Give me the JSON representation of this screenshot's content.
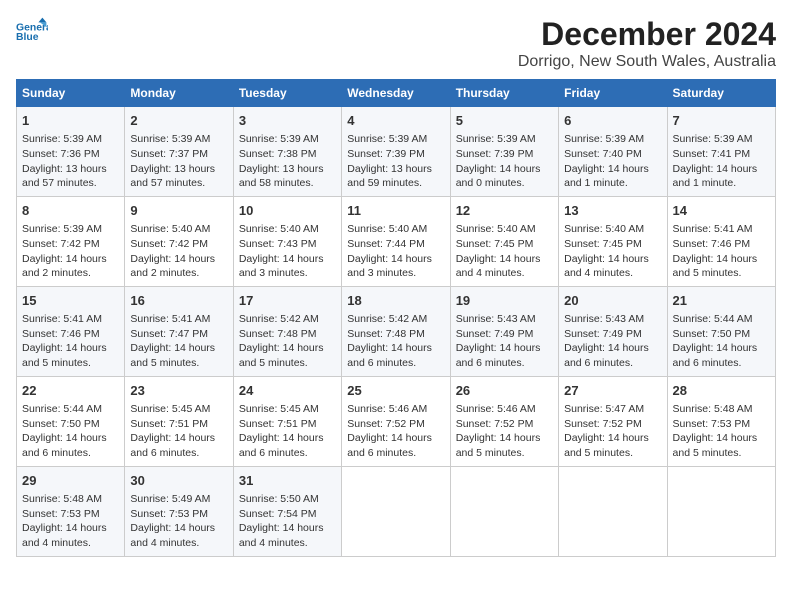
{
  "logo": {
    "line1": "General",
    "line2": "Blue"
  },
  "title": "December 2024",
  "subtitle": "Dorrigo, New South Wales, Australia",
  "days_of_week": [
    "Sunday",
    "Monday",
    "Tuesday",
    "Wednesday",
    "Thursday",
    "Friday",
    "Saturday"
  ],
  "weeks": [
    [
      {
        "day": "1",
        "sunrise": "Sunrise: 5:39 AM",
        "sunset": "Sunset: 7:36 PM",
        "daylight": "Daylight: 13 hours and 57 minutes."
      },
      {
        "day": "2",
        "sunrise": "Sunrise: 5:39 AM",
        "sunset": "Sunset: 7:37 PM",
        "daylight": "Daylight: 13 hours and 57 minutes."
      },
      {
        "day": "3",
        "sunrise": "Sunrise: 5:39 AM",
        "sunset": "Sunset: 7:38 PM",
        "daylight": "Daylight: 13 hours and 58 minutes."
      },
      {
        "day": "4",
        "sunrise": "Sunrise: 5:39 AM",
        "sunset": "Sunset: 7:39 PM",
        "daylight": "Daylight: 13 hours and 59 minutes."
      },
      {
        "day": "5",
        "sunrise": "Sunrise: 5:39 AM",
        "sunset": "Sunset: 7:39 PM",
        "daylight": "Daylight: 14 hours and 0 minutes."
      },
      {
        "day": "6",
        "sunrise": "Sunrise: 5:39 AM",
        "sunset": "Sunset: 7:40 PM",
        "daylight": "Daylight: 14 hours and 1 minute."
      },
      {
        "day": "7",
        "sunrise": "Sunrise: 5:39 AM",
        "sunset": "Sunset: 7:41 PM",
        "daylight": "Daylight: 14 hours and 1 minute."
      }
    ],
    [
      {
        "day": "8",
        "sunrise": "Sunrise: 5:39 AM",
        "sunset": "Sunset: 7:42 PM",
        "daylight": "Daylight: 14 hours and 2 minutes."
      },
      {
        "day": "9",
        "sunrise": "Sunrise: 5:40 AM",
        "sunset": "Sunset: 7:42 PM",
        "daylight": "Daylight: 14 hours and 2 minutes."
      },
      {
        "day": "10",
        "sunrise": "Sunrise: 5:40 AM",
        "sunset": "Sunset: 7:43 PM",
        "daylight": "Daylight: 14 hours and 3 minutes."
      },
      {
        "day": "11",
        "sunrise": "Sunrise: 5:40 AM",
        "sunset": "Sunset: 7:44 PM",
        "daylight": "Daylight: 14 hours and 3 minutes."
      },
      {
        "day": "12",
        "sunrise": "Sunrise: 5:40 AM",
        "sunset": "Sunset: 7:45 PM",
        "daylight": "Daylight: 14 hours and 4 minutes."
      },
      {
        "day": "13",
        "sunrise": "Sunrise: 5:40 AM",
        "sunset": "Sunset: 7:45 PM",
        "daylight": "Daylight: 14 hours and 4 minutes."
      },
      {
        "day": "14",
        "sunrise": "Sunrise: 5:41 AM",
        "sunset": "Sunset: 7:46 PM",
        "daylight": "Daylight: 14 hours and 5 minutes."
      }
    ],
    [
      {
        "day": "15",
        "sunrise": "Sunrise: 5:41 AM",
        "sunset": "Sunset: 7:46 PM",
        "daylight": "Daylight: 14 hours and 5 minutes."
      },
      {
        "day": "16",
        "sunrise": "Sunrise: 5:41 AM",
        "sunset": "Sunset: 7:47 PM",
        "daylight": "Daylight: 14 hours and 5 minutes."
      },
      {
        "day": "17",
        "sunrise": "Sunrise: 5:42 AM",
        "sunset": "Sunset: 7:48 PM",
        "daylight": "Daylight: 14 hours and 5 minutes."
      },
      {
        "day": "18",
        "sunrise": "Sunrise: 5:42 AM",
        "sunset": "Sunset: 7:48 PM",
        "daylight": "Daylight: 14 hours and 6 minutes."
      },
      {
        "day": "19",
        "sunrise": "Sunrise: 5:43 AM",
        "sunset": "Sunset: 7:49 PM",
        "daylight": "Daylight: 14 hours and 6 minutes."
      },
      {
        "day": "20",
        "sunrise": "Sunrise: 5:43 AM",
        "sunset": "Sunset: 7:49 PM",
        "daylight": "Daylight: 14 hours and 6 minutes."
      },
      {
        "day": "21",
        "sunrise": "Sunrise: 5:44 AM",
        "sunset": "Sunset: 7:50 PM",
        "daylight": "Daylight: 14 hours and 6 minutes."
      }
    ],
    [
      {
        "day": "22",
        "sunrise": "Sunrise: 5:44 AM",
        "sunset": "Sunset: 7:50 PM",
        "daylight": "Daylight: 14 hours and 6 minutes."
      },
      {
        "day": "23",
        "sunrise": "Sunrise: 5:45 AM",
        "sunset": "Sunset: 7:51 PM",
        "daylight": "Daylight: 14 hours and 6 minutes."
      },
      {
        "day": "24",
        "sunrise": "Sunrise: 5:45 AM",
        "sunset": "Sunset: 7:51 PM",
        "daylight": "Daylight: 14 hours and 6 minutes."
      },
      {
        "day": "25",
        "sunrise": "Sunrise: 5:46 AM",
        "sunset": "Sunset: 7:52 PM",
        "daylight": "Daylight: 14 hours and 6 minutes."
      },
      {
        "day": "26",
        "sunrise": "Sunrise: 5:46 AM",
        "sunset": "Sunset: 7:52 PM",
        "daylight": "Daylight: 14 hours and 5 minutes."
      },
      {
        "day": "27",
        "sunrise": "Sunrise: 5:47 AM",
        "sunset": "Sunset: 7:52 PM",
        "daylight": "Daylight: 14 hours and 5 minutes."
      },
      {
        "day": "28",
        "sunrise": "Sunrise: 5:48 AM",
        "sunset": "Sunset: 7:53 PM",
        "daylight": "Daylight: 14 hours and 5 minutes."
      }
    ],
    [
      {
        "day": "29",
        "sunrise": "Sunrise: 5:48 AM",
        "sunset": "Sunset: 7:53 PM",
        "daylight": "Daylight: 14 hours and 4 minutes."
      },
      {
        "day": "30",
        "sunrise": "Sunrise: 5:49 AM",
        "sunset": "Sunset: 7:53 PM",
        "daylight": "Daylight: 14 hours and 4 minutes."
      },
      {
        "day": "31",
        "sunrise": "Sunrise: 5:50 AM",
        "sunset": "Sunset: 7:54 PM",
        "daylight": "Daylight: 14 hours and 4 minutes."
      },
      null,
      null,
      null,
      null
    ]
  ]
}
